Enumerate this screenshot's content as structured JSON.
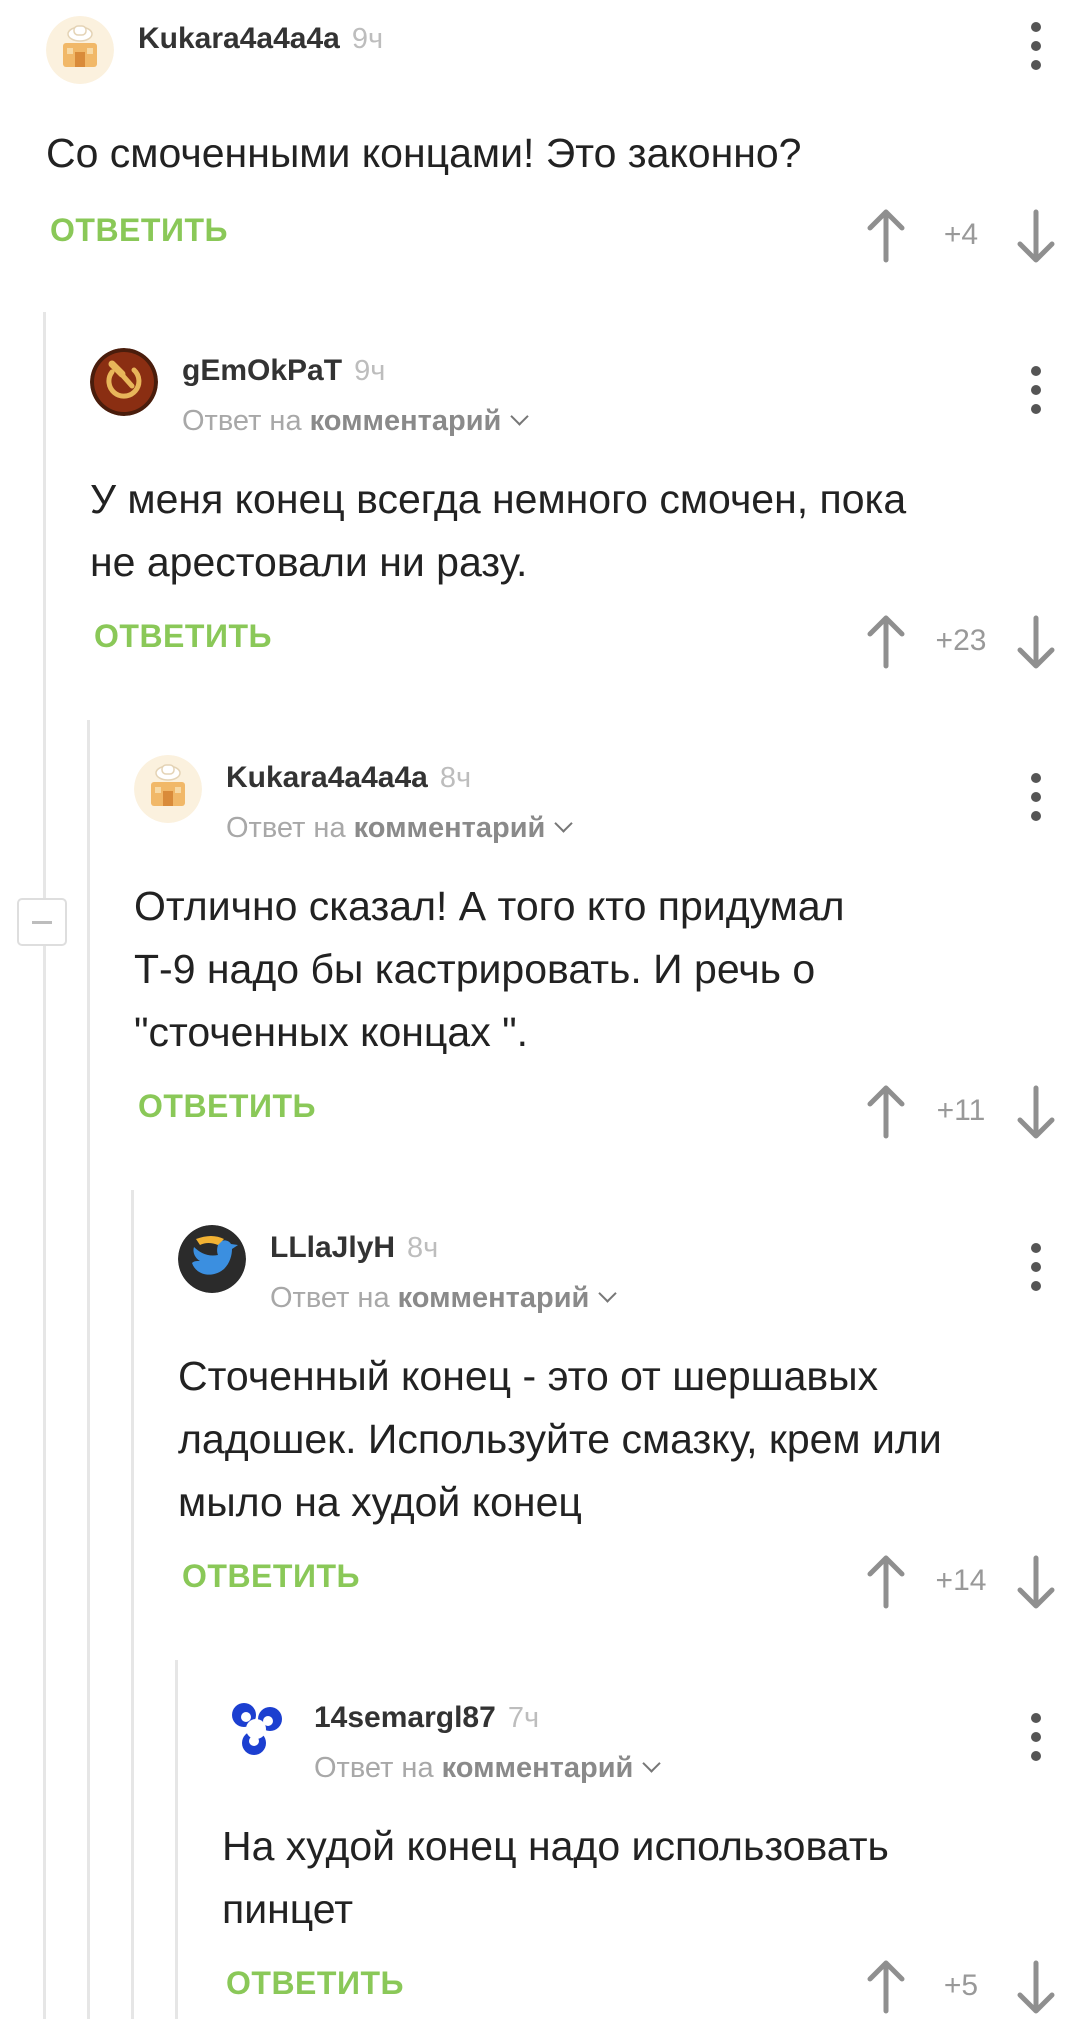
{
  "accent_color": "#8ac858",
  "comments": [
    {
      "author": "Kukara4a4a4a",
      "time": "9ч",
      "reply_to": null,
      "text": "Со смоченными концами! Это законно?",
      "reply_label": "ОТВЕТИТЬ",
      "score": "+4",
      "avatar_icon": "house-avatar-icon"
    },
    {
      "author": "gEmOkPaT",
      "time": "9ч",
      "reply_to": {
        "prefix": "Ответ на",
        "target": "комментарий"
      },
      "text": "У меня конец всегда немного смочен, пока\nне арестовали ни разу.",
      "reply_label": "ОТВЕТИТЬ",
      "score": "+23",
      "avatar_icon": "hammer-sickle-avatar-icon"
    },
    {
      "author": "Kukara4a4a4a",
      "time": "8ч",
      "reply_to": {
        "prefix": "Ответ на",
        "target": "комментарий"
      },
      "text": "Отлично сказал! А того кто придумал\nТ-9 надо бы кастрировать. И речь о\n\"сточенных концах \".",
      "reply_label": "ОТВЕТИТЬ",
      "score": "+11",
      "avatar_icon": "house-avatar-icon"
    },
    {
      "author": "LLlaJlyH",
      "time": "8ч",
      "reply_to": {
        "prefix": "Ответ на",
        "target": "комментарий"
      },
      "text": "Сточенный конец - это от шершавых\nладошек. Используйте смазку, крем или\nмыло на худой конец",
      "reply_label": "ОТВЕТИТЬ",
      "score": "+14",
      "avatar_icon": "blue-bird-avatar-icon"
    },
    {
      "author": "14semargl87",
      "time": "7ч",
      "reply_to": {
        "prefix": "Ответ на",
        "target": "комментарий"
      },
      "text": "На худой конец надо использовать\nпинцет",
      "reply_label": "ОТВЕТИТЬ",
      "score": "+5",
      "avatar_icon": "blue-swirl-avatar-icon"
    }
  ]
}
